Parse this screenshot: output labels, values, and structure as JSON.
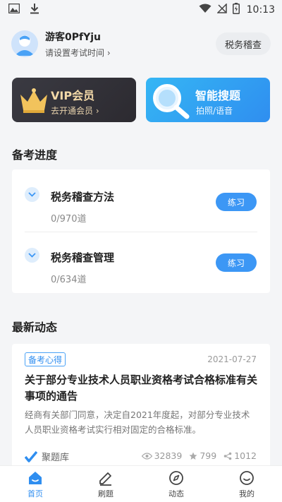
{
  "status_bar": {
    "time": "10:13"
  },
  "header": {
    "username": "游客0PfYju",
    "exam_time_prompt": "请设置考试时间",
    "subject_button": "税务稽查"
  },
  "promos": {
    "vip": {
      "title": "VIP会员",
      "subtitle": "去开通会员"
    },
    "search": {
      "title": "智能搜题",
      "subtitle": "拍照/语音"
    }
  },
  "progress": {
    "section_title": "备考进度",
    "items": [
      {
        "title": "税务稽查方法",
        "count": "0/970道",
        "button": "练习"
      },
      {
        "title": "税务稽查管理",
        "count": "0/634道",
        "button": "练习"
      }
    ]
  },
  "news": {
    "section_title": "最新动态",
    "tag": "备考心得",
    "date": "2021-07-27",
    "title": "关于部分专业技术人员职业资格考试合格标准有关事项的通告",
    "summary": "经商有关部门同意，决定自2021年度起，对部分专业技术人员职业资格考试实行相对固定的合格标准。",
    "source": "聚题库",
    "views": "32839",
    "likes": "799",
    "shares": "1012"
  },
  "tabbar": {
    "items": [
      {
        "label": "首页",
        "icon": "home-icon",
        "active": true
      },
      {
        "label": "刷题",
        "icon": "pencil-icon",
        "active": false
      },
      {
        "label": "动态",
        "icon": "compass-icon",
        "active": false
      },
      {
        "label": "我的",
        "icon": "profile-icon",
        "active": false
      }
    ]
  },
  "colors": {
    "accent": "#2f8ef0",
    "vip_gold": "#f3d9a8",
    "background": "#f4f5f7"
  }
}
